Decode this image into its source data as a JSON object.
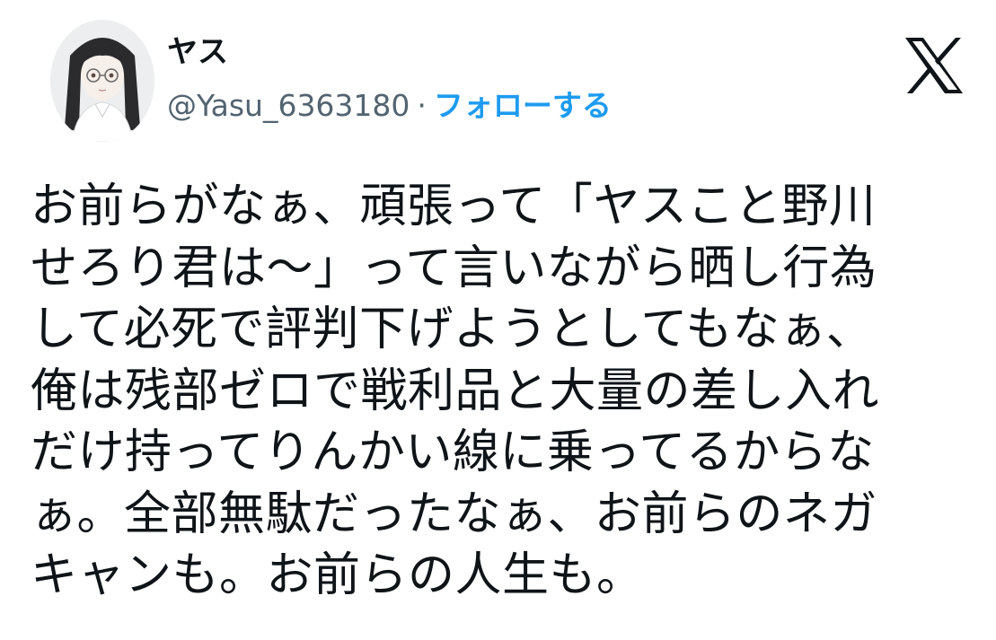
{
  "author": {
    "display_name": "ヤス",
    "handle": "@Yasu_6363180",
    "separator": "·",
    "follow_label": "フォローする",
    "avatar_icon": "avatar-illustration"
  },
  "brand": {
    "logo_icon": "x-logo-icon",
    "logo_color": "#0f1419",
    "follow_color": "#1d9bf0",
    "secondary_text_color": "#536471"
  },
  "tweet": {
    "lines": [
      "お前らがなぁ、頑張って「ヤスこと野川",
      "せろり君は〜」って言いながら晒し行為",
      "して必死で評判下げようとしてもなぁ、",
      "俺は残部ゼロで戦利品と大量の差し入れ",
      "だけ持ってりんかい線に乗ってるからな",
      "ぁ。全部無駄だったなぁ、お前らのネガ",
      "キャンも。お前らの人生も。"
    ]
  }
}
